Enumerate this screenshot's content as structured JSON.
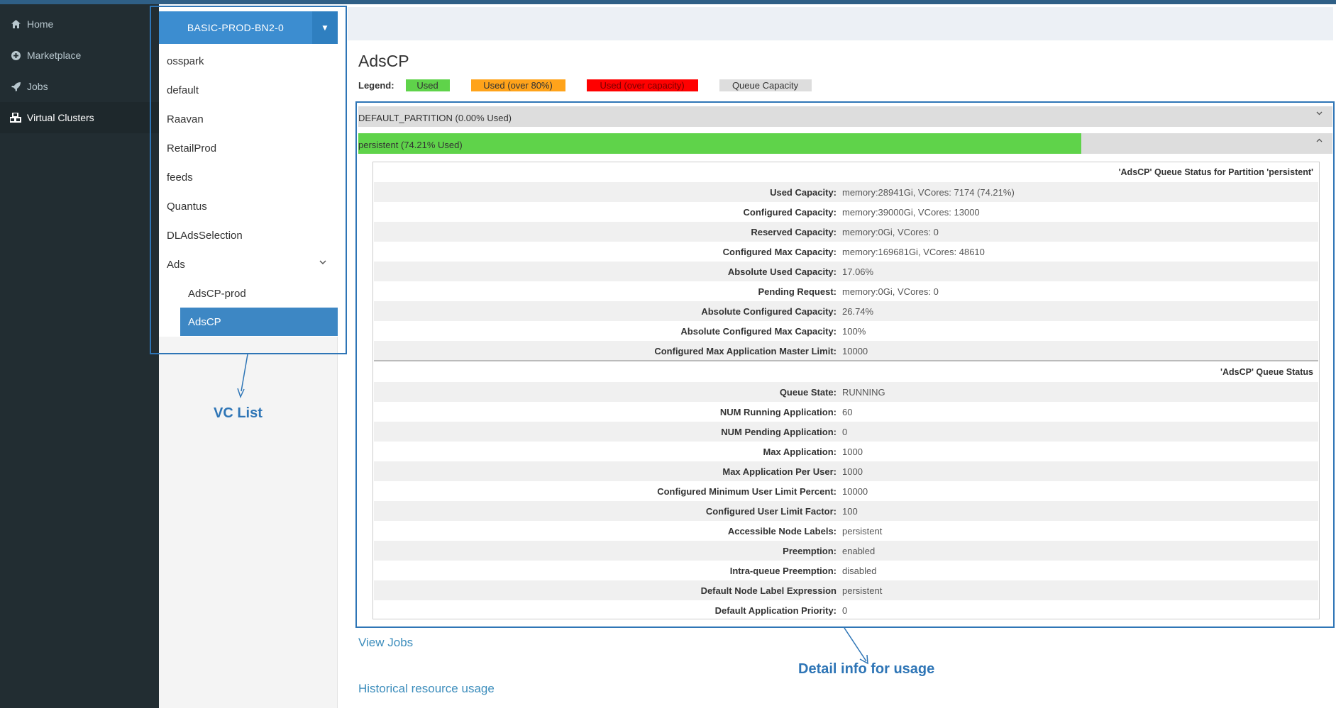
{
  "nav": {
    "items": [
      {
        "label": "Home",
        "icon": "home-icon"
      },
      {
        "label": "Marketplace",
        "icon": "plus-circle-icon"
      },
      {
        "label": "Jobs",
        "icon": "rocket-icon"
      },
      {
        "label": "Virtual Clusters",
        "icon": "cubes-icon",
        "active": true
      }
    ]
  },
  "vc": {
    "cluster_name": "BASIC-PROD-BN2-0",
    "items": [
      "osspark",
      "default",
      "Raavan",
      "RetailProd",
      "feeds",
      "Quantus",
      "DLAdsSelection",
      "Ads"
    ],
    "sub_items": [
      "AdsCP-prod",
      "AdsCP"
    ],
    "selected": "AdsCP"
  },
  "annotations": {
    "vc_list": "VC List",
    "detail_info": "Detail info for usage"
  },
  "main": {
    "title": "AdsCP",
    "legend": {
      "label": "Legend:",
      "used": "Used",
      "used_over_80": "Used (over 80%)",
      "used_over_capacity": "Used (over capacity)",
      "queue_capacity": "Queue Capacity"
    },
    "partitions": [
      {
        "label": "DEFAULT_PARTITION (0.00% Used)",
        "used_percent": 0.0
      },
      {
        "label": "persistent (74.21% Used)",
        "used_percent": 74.21
      }
    ],
    "partition_status": {
      "heading": "'AdsCP' Queue Status for Partition 'persistent'",
      "rows": [
        {
          "key": "Used Capacity:",
          "value": "memory:28941Gi, VCores: 7174 (74.21%)"
        },
        {
          "key": "Configured Capacity:",
          "value": "memory:39000Gi, VCores: 13000"
        },
        {
          "key": "Reserved Capacity:",
          "value": "memory:0Gi, VCores: 0"
        },
        {
          "key": "Configured Max Capacity:",
          "value": "memory:169681Gi, VCores: 48610"
        },
        {
          "key": "Absolute Used Capacity:",
          "value": "17.06%"
        },
        {
          "key": "Pending Request:",
          "value": "memory:0Gi, VCores: 0"
        },
        {
          "key": "Absolute Configured Capacity:",
          "value": "26.74%"
        },
        {
          "key": "Absolute Configured Max Capacity:",
          "value": "100%"
        },
        {
          "key": "Configured Max Application Master Limit:",
          "value": "10000"
        }
      ]
    },
    "queue_status": {
      "heading": "'AdsCP' Queue Status",
      "rows": [
        {
          "key": "Queue State:",
          "value": "RUNNING"
        },
        {
          "key": "NUM Running Application:",
          "value": "60"
        },
        {
          "key": "NUM Pending Application:",
          "value": "0"
        },
        {
          "key": "Max Application:",
          "value": "1000"
        },
        {
          "key": "Max Application Per User:",
          "value": "1000"
        },
        {
          "key": "Configured Minimum User Limit Percent:",
          "value": "10000"
        },
        {
          "key": "Configured User Limit Factor:",
          "value": "100"
        },
        {
          "key": "Accessible Node Labels:",
          "value": "persistent"
        },
        {
          "key": "Preemption:",
          "value": "enabled"
        },
        {
          "key": "Intra-queue Preemption:",
          "value": "disabled"
        },
        {
          "key": "Default Node Label Expression",
          "value": "persistent"
        },
        {
          "key": "Default Application Priority:",
          "value": "0"
        }
      ]
    },
    "links": {
      "view_jobs": "View Jobs",
      "historical": "Historical resource usage"
    }
  },
  "colors": {
    "used": "#5fd34a",
    "used_over_80": "#ffa31a",
    "used_over_capacity": "#ff0000",
    "queue_capacity": "#dddddd",
    "accent": "#3c8dd0",
    "annotation": "#2e75b6"
  }
}
